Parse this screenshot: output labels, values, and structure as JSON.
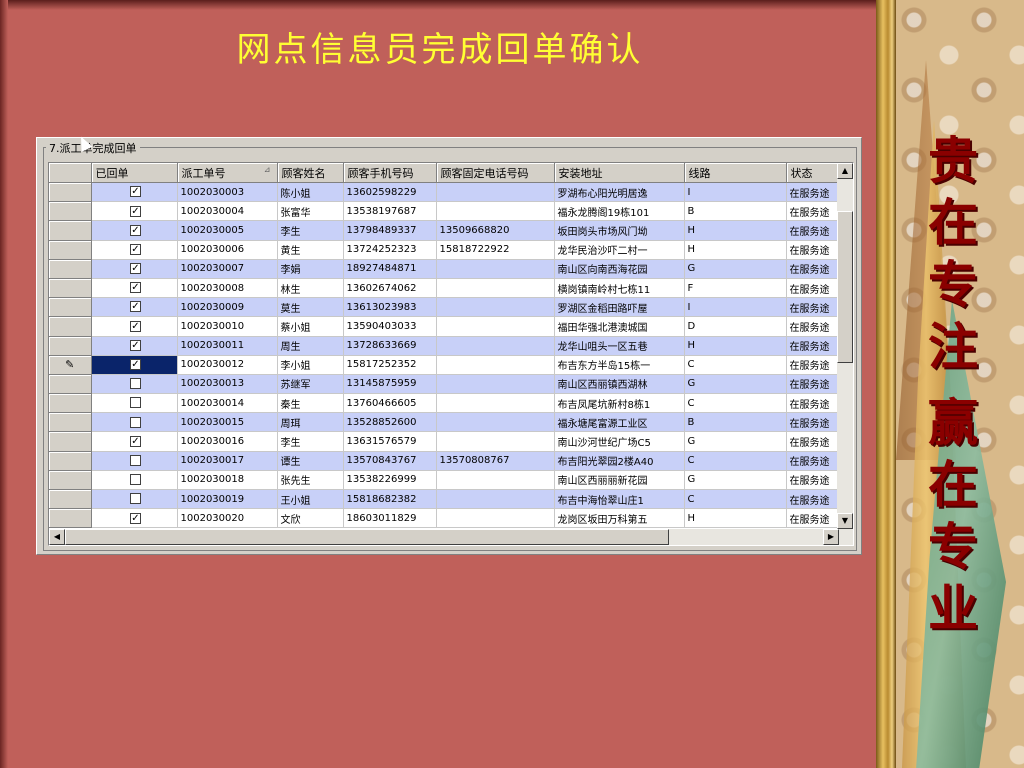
{
  "slide": {
    "title": "网点信息员完成回单确认",
    "slogan_line1": [
      "贵",
      "在",
      "专",
      "注"
    ],
    "slogan_line2": [
      "赢",
      "在",
      "专",
      "业"
    ]
  },
  "window": {
    "group_caption": "7.派工单完成回单",
    "columns": [
      "已回单",
      "派工单号",
      "顾客姓名",
      "顾客手机号码",
      "顾客固定电话号码",
      "安装地址",
      "线路",
      "状态"
    ],
    "sort_indicator_column": "派工单号",
    "selected_row_index": 9,
    "rows": [
      {
        "checked": true,
        "order_no": "1002030003",
        "name": "陈小姐",
        "mobile": "13602598229",
        "phone": "",
        "address": "罗湖布心阳光明居逸",
        "route": "I",
        "status": "在服务途"
      },
      {
        "checked": true,
        "order_no": "1002030004",
        "name": "张富华",
        "mobile": "13538197687",
        "phone": "",
        "address": "福永龙腾阁19栋101",
        "route": "B",
        "status": "在服务途"
      },
      {
        "checked": true,
        "order_no": "1002030005",
        "name": "李生",
        "mobile": "13798489337",
        "phone": "13509668820",
        "address": "坂田岗头市场风门坳",
        "route": "H",
        "status": "在服务途"
      },
      {
        "checked": true,
        "order_no": "1002030006",
        "name": "黄生",
        "mobile": "13724252323",
        "phone": "15818722922",
        "address": "龙华民治沙吓二村一",
        "route": "H",
        "status": "在服务途"
      },
      {
        "checked": true,
        "order_no": "1002030007",
        "name": "李娟",
        "mobile": "18927484871",
        "phone": "",
        "address": "南山区向南西海花园",
        "route": "G",
        "status": "在服务途"
      },
      {
        "checked": true,
        "order_no": "1002030008",
        "name": "林生",
        "mobile": "13602674062",
        "phone": "",
        "address": "横岗镇南岭村七栋11",
        "route": "F",
        "status": "在服务途"
      },
      {
        "checked": true,
        "order_no": "1002030009",
        "name": "莫生",
        "mobile": "13613023983",
        "phone": "",
        "address": "罗湖区金稻田路吓屋",
        "route": "I",
        "status": "在服务途"
      },
      {
        "checked": true,
        "order_no": "1002030010",
        "name": "蔡小姐",
        "mobile": "13590403033",
        "phone": "",
        "address": "福田华强北港澳城国",
        "route": "D",
        "status": "在服务途"
      },
      {
        "checked": true,
        "order_no": "1002030011",
        "name": "周生",
        "mobile": "13728633669",
        "phone": "",
        "address": "龙华山咀头一区五巷",
        "route": "H",
        "status": "在服务途"
      },
      {
        "checked": true,
        "order_no": "1002030012",
        "name": "李小姐",
        "mobile": "15817252352",
        "phone": "",
        "address": "布吉东方半岛15栋一",
        "route": "C",
        "status": "在服务途"
      },
      {
        "checked": false,
        "order_no": "1002030013",
        "name": "苏继军",
        "mobile": "13145875959",
        "phone": "",
        "address": "南山区西丽镇西湖林",
        "route": "G",
        "status": "在服务途"
      },
      {
        "checked": false,
        "order_no": "1002030014",
        "name": "秦生",
        "mobile": "13760466605",
        "phone": "",
        "address": "布吉凤尾坑新村8栋1",
        "route": "C",
        "status": "在服务途"
      },
      {
        "checked": false,
        "order_no": "1002030015",
        "name": "周珥",
        "mobile": "13528852600",
        "phone": "",
        "address": "福永塘尾富源工业区",
        "route": "B",
        "status": "在服务途"
      },
      {
        "checked": true,
        "order_no": "1002030016",
        "name": "李生",
        "mobile": "13631576579",
        "phone": "",
        "address": "南山沙河世纪广场C5",
        "route": "G",
        "status": "在服务途"
      },
      {
        "checked": false,
        "order_no": "1002030017",
        "name": "谭生",
        "mobile": "13570843767",
        "phone": "13570808767",
        "address": "布吉阳光翠园2楼A40",
        "route": "C",
        "status": "在服务途"
      },
      {
        "checked": false,
        "order_no": "1002030018",
        "name": "张先生",
        "mobile": "13538226999",
        "phone": "",
        "address": "南山区西丽丽新花园",
        "route": "G",
        "status": "在服务途"
      },
      {
        "checked": false,
        "order_no": "1002030019",
        "name": "王小姐",
        "mobile": "15818682382",
        "phone": "",
        "address": "布吉中海怡翠山庄1",
        "route": "C",
        "status": "在服务途"
      },
      {
        "checked": true,
        "order_no": "1002030020",
        "name": "文欣",
        "mobile": "18603011829",
        "phone": "",
        "address": "龙岗区坂田万科第五",
        "route": "H",
        "status": "在服务途"
      }
    ],
    "icons": {
      "edit_row_indicator": "pencil-icon",
      "scroll_up": "arrow-up-icon",
      "scroll_down": "arrow-down-icon",
      "scroll_left": "arrow-left-icon",
      "scroll_right": "arrow-right-icon",
      "mouse_cursor": "mouse-pointer-icon"
    }
  },
  "colors": {
    "slide_bg": "#c0605a",
    "title": "#ffff33",
    "slogan": "#8a0000",
    "row_alt": "#c8d0f8",
    "selection": "#0a246a"
  }
}
